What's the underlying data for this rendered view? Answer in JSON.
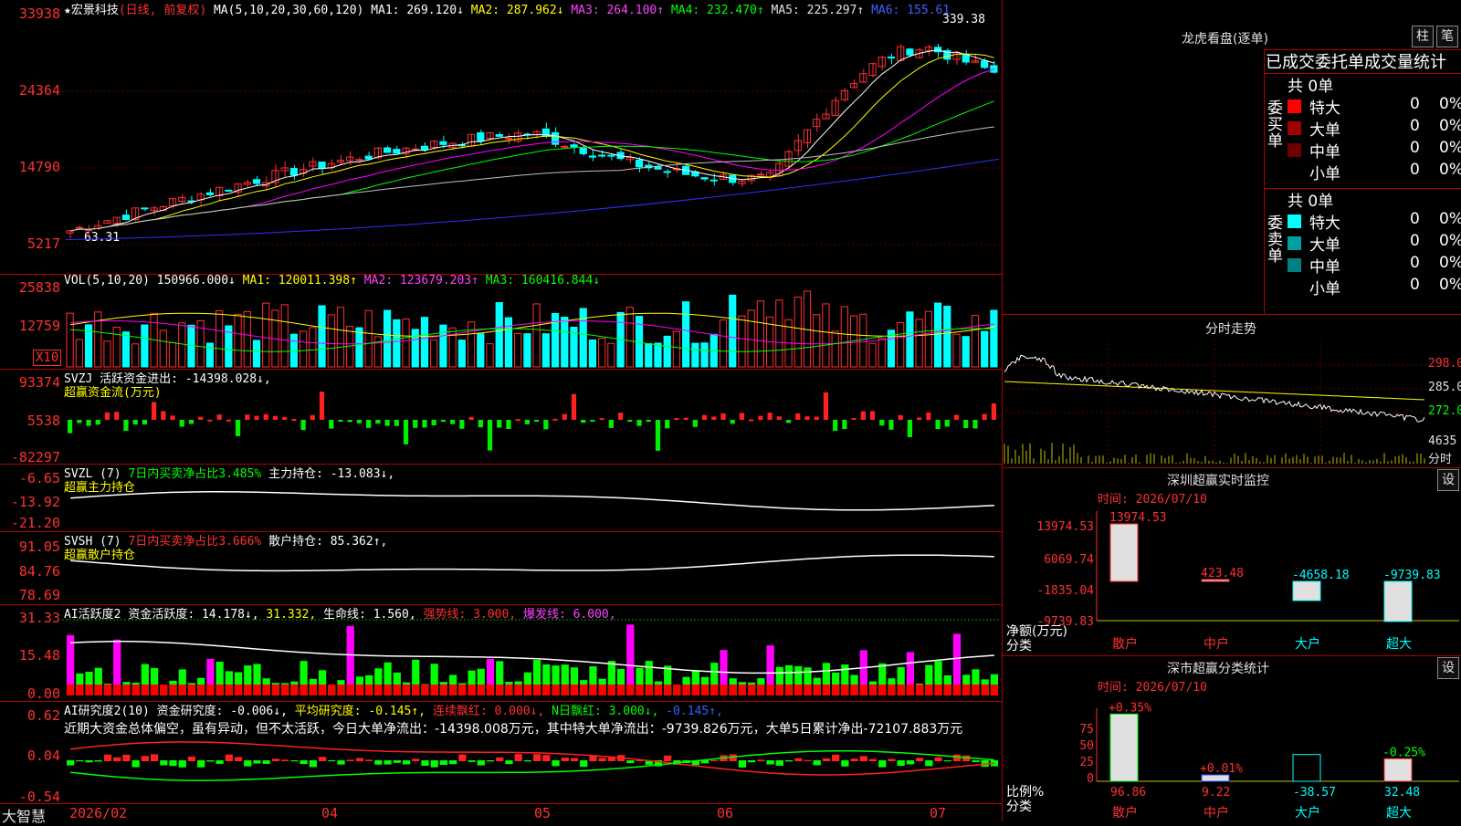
{
  "stock": {
    "name": "宏景科技",
    "star": "★",
    "mode": "(日线, 前复权)"
  },
  "ma_legend": {
    "label": "MA(5,10,20,30,60,120)",
    "ma1": "MA1: 269.120↓",
    "ma2": "MA2: 287.962↓",
    "ma3": "MA3: 264.100↑",
    "ma4": "MA4: 232.470↑",
    "ma5": "MA5: 225.297↑",
    "ma6": "MA6: 155.61"
  },
  "price_axis": [
    "33938",
    "24364",
    "14790",
    "5217"
  ],
  "price_marks": {
    "high": "339.38",
    "low": "63.31"
  },
  "vol_legend": {
    "label": "VOL(5,10,20)",
    "v": "150966.000↓",
    "ma1": "MA1: 120011.398↑",
    "ma2": "MA2: 123679.203↑",
    "ma3": "MA3: 160416.844↓"
  },
  "vol_axis": [
    "25838",
    "12759"
  ],
  "vol_unit": "X10",
  "svzj": {
    "label": "SVZJ",
    "text": "活跃资金进出: -14398.028↓,",
    "sub": "超赢资金流(万元)",
    "axis": [
      "93374",
      "5538",
      "-82297"
    ]
  },
  "svzl": {
    "label": "SVZL (7)",
    "text1": "7日内买卖净占比3.485%",
    "text2": "主力持仓: -13.083↓,",
    "sub": "超赢主力持仓",
    "axis": [
      "-6.65",
      "-13.92",
      "-21.20"
    ]
  },
  "svsh": {
    "label": "SVSH (7)",
    "text1": "7日内买卖净占比3.666%",
    "text2": "散户持仓: 85.362↑,",
    "sub": "超赢散户持仓",
    "axis": [
      "91.05",
      "84.76",
      "78.69"
    ]
  },
  "ai2": {
    "label": "AI活跃度2",
    "t1": "资金活跃度: 14.178↓,",
    "t2": "31.332,",
    "t3": "生命线: 1.560,",
    "t4": "强势线: 3.000,",
    "t5": "爆发线: 6.000,",
    "axis": [
      "31.33",
      "15.48",
      "0.00"
    ]
  },
  "ai_research": {
    "label": "AI研究度2(10)",
    "t1": "资金研究度: -0.006↓,",
    "t2": "平均研究度: -0.145↑,",
    "t3": "连续飘红: 0.000↓,",
    "t4": "N日飘红: 3.000↓,",
    "t5": "-0.145↑,",
    "axis": [
      "0.62",
      "0.04",
      "-0.54"
    ],
    "comment": "近期大资金总体偏空，虽有异动，但不太活跃，今日大单净流出：-14398.008万元，其中特大单净流出：-9739.826万元，大单5日累计净出-72107.883万元"
  },
  "dates": [
    "2026/02",
    "04",
    "05",
    "06",
    "07"
  ],
  "brand": "大智慧",
  "right": {
    "lhb_title": "龙虎看盘(逐单)",
    "btn_col": "柱",
    "btn_pen": "笔",
    "deal_title": "已成交委托单成交量统计",
    "buy_label": "委买单",
    "sell_label": "委卖单",
    "buy_total": "共 0单",
    "sell_total": "共 0单",
    "buy_rows": [
      {
        "name": "特大",
        "n": "0",
        "p": "0%",
        "color": "#ff0000"
      },
      {
        "name": "大单",
        "n": "0",
        "p": "0%",
        "color": "#a00000"
      },
      {
        "name": "中单",
        "n": "0",
        "p": "0%",
        "color": "#700000"
      },
      {
        "name": "小单",
        "n": "0",
        "p": "0%",
        "color": "#000000"
      }
    ],
    "sell_rows": [
      {
        "name": "特大",
        "n": "0",
        "p": "0%",
        "color": "#00ffff"
      },
      {
        "name": "大单",
        "n": "0",
        "p": "0%",
        "color": "#00a0a0"
      },
      {
        "name": "中单",
        "n": "0",
        "p": "0%",
        "color": "#008080"
      },
      {
        "name": "小单",
        "n": "0",
        "p": "0%",
        "color": "#000000"
      }
    ],
    "intraday_title": "分时走势",
    "intraday_axis": [
      "298.0",
      "285.0",
      "272.0"
    ],
    "intraday_vol": "4635",
    "intraday_unit": "分时",
    "monitor_title": "深圳超赢实时监控",
    "monitor_btn": "设",
    "monitor_time": "时间: 2026/07/10",
    "monitor_axis": [
      "13974.53",
      "6069.74",
      "-1835.04",
      "-9739.83"
    ],
    "monitor_values": [
      {
        "cat": "散户",
        "val": "13974.53"
      },
      {
        "cat": "中户",
        "val": "423.48"
      },
      {
        "cat": "大户",
        "val": "-4658.18"
      },
      {
        "cat": "超大",
        "val": "-9739.83"
      }
    ],
    "monitor_ylabel": "净额(万元)",
    "monitor_xlabel": "分类",
    "stat_title": "深市超赢分类统计",
    "stat_btn": "设",
    "stat_time": "时间: 2026/07/10",
    "stat_axis": [
      "75",
      "50",
      "25",
      "0"
    ],
    "stat_top": [
      "+0.35%",
      "+0.01%",
      "",
      "-0.25%"
    ],
    "stat_values": [
      {
        "cat": "散户",
        "val": "96.86"
      },
      {
        "cat": "中户",
        "val": "9.22"
      },
      {
        "cat": "大户",
        "val": "-38.57"
      },
      {
        "cat": "超大",
        "val": "32.48"
      }
    ],
    "stat_ylabel": "比例%",
    "stat_xlabel": "分类"
  },
  "colors": {
    "up": "#ff3030",
    "down": "#00ffff",
    "ma1": "#ffffff",
    "ma2": "#ffff00",
    "ma3": "#ff00ff",
    "ma4": "#00ff00",
    "ma5": "#c0c0c0",
    "ma6": "#3030ff",
    "grid": "#b00000"
  }
}
